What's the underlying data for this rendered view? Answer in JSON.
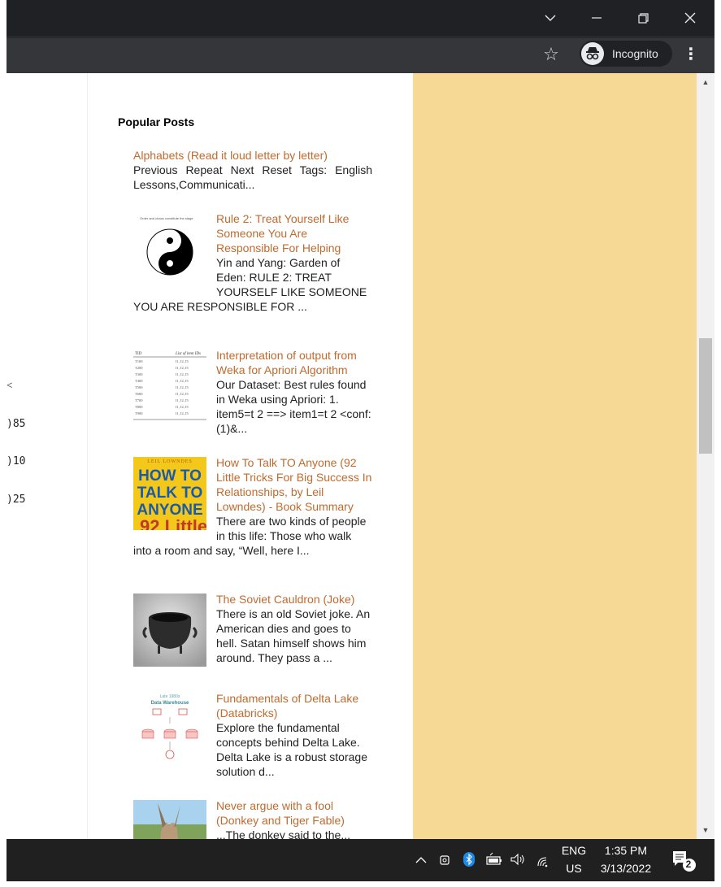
{
  "browser": {
    "incognito_label": "Incognito",
    "star_icon": "star-icon",
    "menu_icon": "kebab-menu-icon"
  },
  "left_sliver": [
    "˂",
    ")85",
    ")10",
    ")25"
  ],
  "widget": {
    "title": "Popular Posts",
    "posts": [
      {
        "title": "Alphabets (Read it loud letter by letter)",
        "snippet": "Previous Repeat Next Reset Tags: English Lessons,Communicati...",
        "thumb": null
      },
      {
        "title": "Rule 2: Treat Yourself Like Someone You Are Responsible For Helping",
        "snippet": "Yin and Yang: Garden of Eden: RULE 2: TREAT YOURSELF LIKE SOMEONE YOU ARE RESPONSIBLE FOR ...",
        "thumb": "yin-yang-thumbnail",
        "thumb_caption": "Order and chaos constitute the stage"
      },
      {
        "title": "Interpretation of output from Weka for Apriori Algorithm",
        "snippet": "Our Dataset: Best rules found in Weka using Apriori: 1. item5=t 2 ==> item1=t 2 <conf:(1)&...",
        "thumb": "table-thumbnail",
        "thumb_header": [
          "TID",
          "List of item IDs"
        ],
        "thumb_rows": [
          "T100",
          "T200",
          "T300",
          "T400",
          "T500",
          "T600",
          "T700",
          "T800",
          "T900"
        ]
      },
      {
        "title": "How To Talk TO Anyone (92 Little Tricks For Big Success In Relationships, by Leil Lowndes) - Book Summary",
        "snippet": "There are two kinds of people in this life: Those who walk into a room and say, “Well, here I...",
        "thumb": "book-cover-thumbnail",
        "thumb_author": "LEIL LOWNDES",
        "thumb_lines": [
          "HOW TO",
          "TALK TO",
          "ANYONE"
        ],
        "thumb_bottom": "92 Little"
      },
      {
        "title": "The Soviet Cauldron (Joke)",
        "snippet": "There is an old Soviet joke. An American dies and goes to hell. Satan himself shows him around. They pass a ...",
        "thumb": "cauldron-thumbnail"
      },
      {
        "title": "Fundamentals of Delta Lake (Databricks)",
        "snippet": "Explore the fundamental concepts behind Delta Lake. Delta Lake is a robust storage solution d...",
        "thumb": "diagram-thumbnail",
        "thumb_caption_1": "Late 1980s",
        "thumb_caption_2": "Data Warehouse"
      },
      {
        "title": "Never argue with a fool (Donkey and Tiger Fable)",
        "snippet": "...The donkey said to the...",
        "thumb": "donkey-thumbnail"
      }
    ]
  },
  "taskbar": {
    "lang_1": "ENG",
    "lang_2": "US",
    "time": "1:35 PM",
    "date": "3/13/2022",
    "notification_count": "2"
  }
}
